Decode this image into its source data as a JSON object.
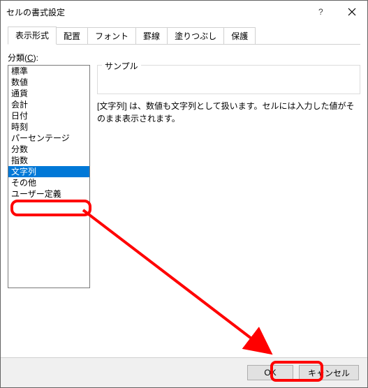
{
  "titlebar": {
    "title": "セルの書式設定"
  },
  "tabs": {
    "items": [
      {
        "label": "表示形式"
      },
      {
        "label": "配置"
      },
      {
        "label": "フォント"
      },
      {
        "label": "罫線"
      },
      {
        "label": "塗りつぶし"
      },
      {
        "label": "保護"
      }
    ],
    "active_index": 0
  },
  "category": {
    "label_prefix": "分類(",
    "label_hotkey": "C",
    "label_suffix": "):",
    "items": [
      "標準",
      "数値",
      "通貨",
      "会計",
      "日付",
      "時刻",
      "パーセンテージ",
      "分数",
      "指数",
      "文字列",
      "その他",
      "ユーザー定義"
    ],
    "selected_index": 9
  },
  "sample": {
    "label": "サンプル"
  },
  "description": {
    "text": "[文字列] は、数値も文字列として扱います。セルには入力した値がそのまま表示されます。"
  },
  "footer": {
    "ok_label": "OK",
    "cancel_label": "キャンセル"
  }
}
